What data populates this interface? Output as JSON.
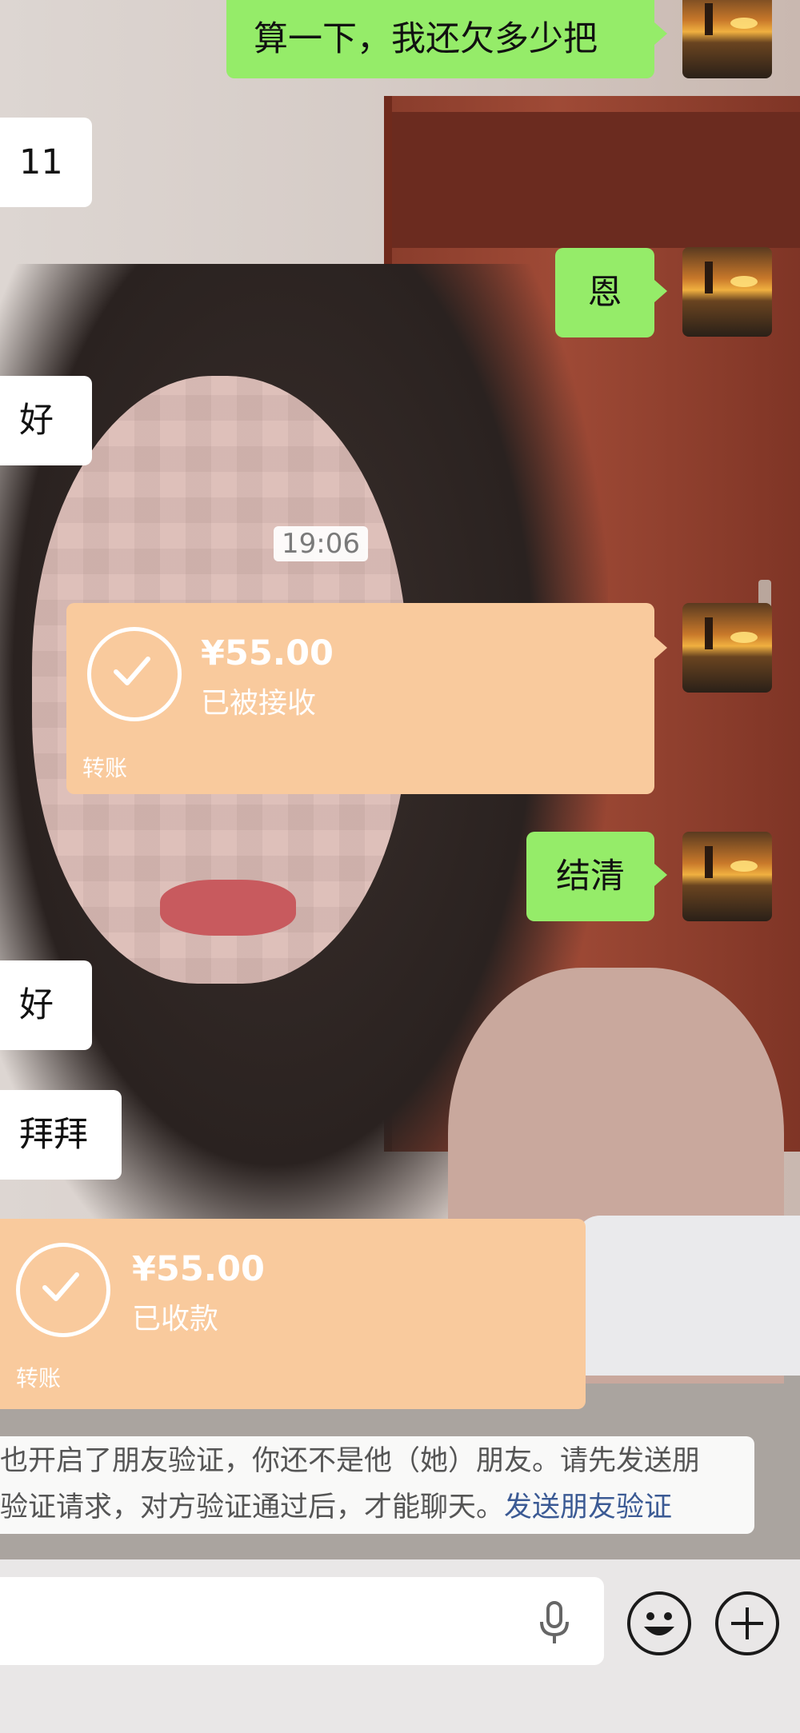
{
  "messages": [
    {
      "side": "out",
      "text": "算一下，我还欠多少把"
    },
    {
      "side": "in",
      "text": "11"
    },
    {
      "side": "out",
      "text": "恩"
    },
    {
      "side": "in",
      "text": "好"
    },
    {
      "side": "out",
      "text": "结清"
    },
    {
      "side": "in",
      "text": "好"
    },
    {
      "side": "in",
      "text": "拜拜"
    }
  ],
  "time_label": "19:06",
  "transfer_sent": {
    "amount": "¥55.00",
    "status": "已被接收",
    "tag": "转账"
  },
  "transfer_received": {
    "amount": "¥55.00",
    "status": "已收款",
    "tag": "转账"
  },
  "notice": {
    "line1": "也开启了朋友验证，你还不是他（她）朋友。请先发送朋",
    "line2_text": "验证请求，对方验证通过后，才能聊天。",
    "line2_link": "发送朋友验证"
  },
  "icons": {
    "voice": "microphone-icon",
    "emoji": "emoji-smile-icon",
    "more": "plus-circle-icon"
  },
  "colors": {
    "bubble_out": "#95ec69",
    "bubble_in": "#ffffff",
    "transfer": "#f9ca9d",
    "link": "#3b5a94"
  }
}
